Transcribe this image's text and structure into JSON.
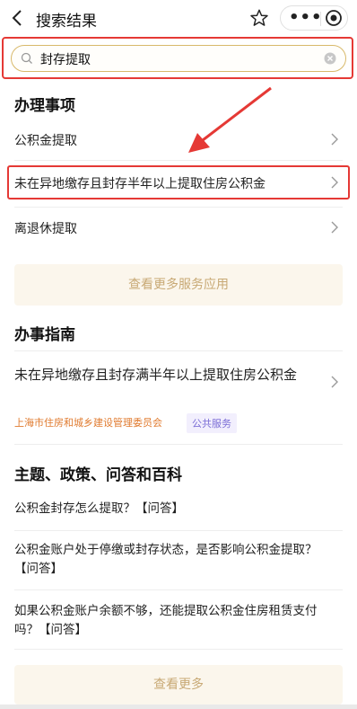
{
  "header": {
    "title": "搜索结果"
  },
  "search": {
    "query": "封存提取"
  },
  "matters": {
    "title": "办理事项",
    "items": [
      {
        "label": "公积金提取"
      },
      {
        "label": "未在异地缴存且封存半年以上提取住房公积金"
      },
      {
        "label": "离退休提取"
      }
    ],
    "more_label": "查看更多服务应用"
  },
  "guide": {
    "title": "办事指南",
    "item_title": "未在异地缴存且封存满半年以上提取住房公积金",
    "org": "上海市住房和城乡建设管理委员会",
    "tag": "公共服务"
  },
  "topics": {
    "title": "主题、政策、问答和百科",
    "items": [
      {
        "text": "公积金封存怎么提取？【问答】"
      },
      {
        "text": "公积金账户处于停缴或封存状态，是否影响公积金提取？【问答】"
      },
      {
        "text": "如果公积金账户余额不够，还能提取公积金住房租赁支付吗？【问答】"
      }
    ],
    "more_label": "查看更多"
  },
  "colors": {
    "highlight": "#e53935",
    "accent": "#c8a975",
    "tag_org": "#e07a2e",
    "tag_pub": "#7b6ed6"
  },
  "icons": [
    "back-icon",
    "star-icon",
    "more-icon",
    "close-circle-icon",
    "search-icon",
    "clear-icon",
    "chevron-right-icon",
    "red-arrow"
  ]
}
